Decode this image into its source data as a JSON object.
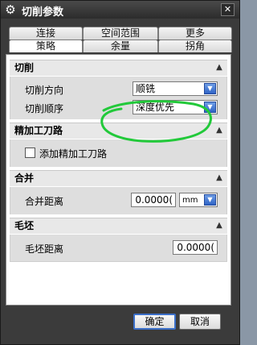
{
  "window": {
    "title": "切削参数",
    "title_icon": "gear-icon",
    "close_label": "✕"
  },
  "tabs": {
    "row1": [
      "连接",
      "空间范围",
      "更多"
    ],
    "row2": [
      "策略",
      "余量",
      "拐角"
    ],
    "active": "策略"
  },
  "sections": {
    "cutting": {
      "title": "切削",
      "direction_label": "切削方向",
      "direction_value": "顺铣",
      "order_label": "切削顺序",
      "order_value": "深度优先"
    },
    "finish": {
      "title": "精加工刀路",
      "add_finish_label": "添加精加工刀路",
      "add_finish_checked": false
    },
    "merge": {
      "title": "合并",
      "distance_label": "合并距离",
      "distance_value": "0.0000(",
      "unit_value": "mm"
    },
    "blank": {
      "title": "毛坯",
      "distance_label": "毛坯距离",
      "distance_value": "0.0000("
    }
  },
  "footer": {
    "ok_label": "确定",
    "cancel_label": "取消"
  },
  "colors": {
    "annotation": "#22c93a",
    "dropdown_arrow": "#2f64c6"
  }
}
